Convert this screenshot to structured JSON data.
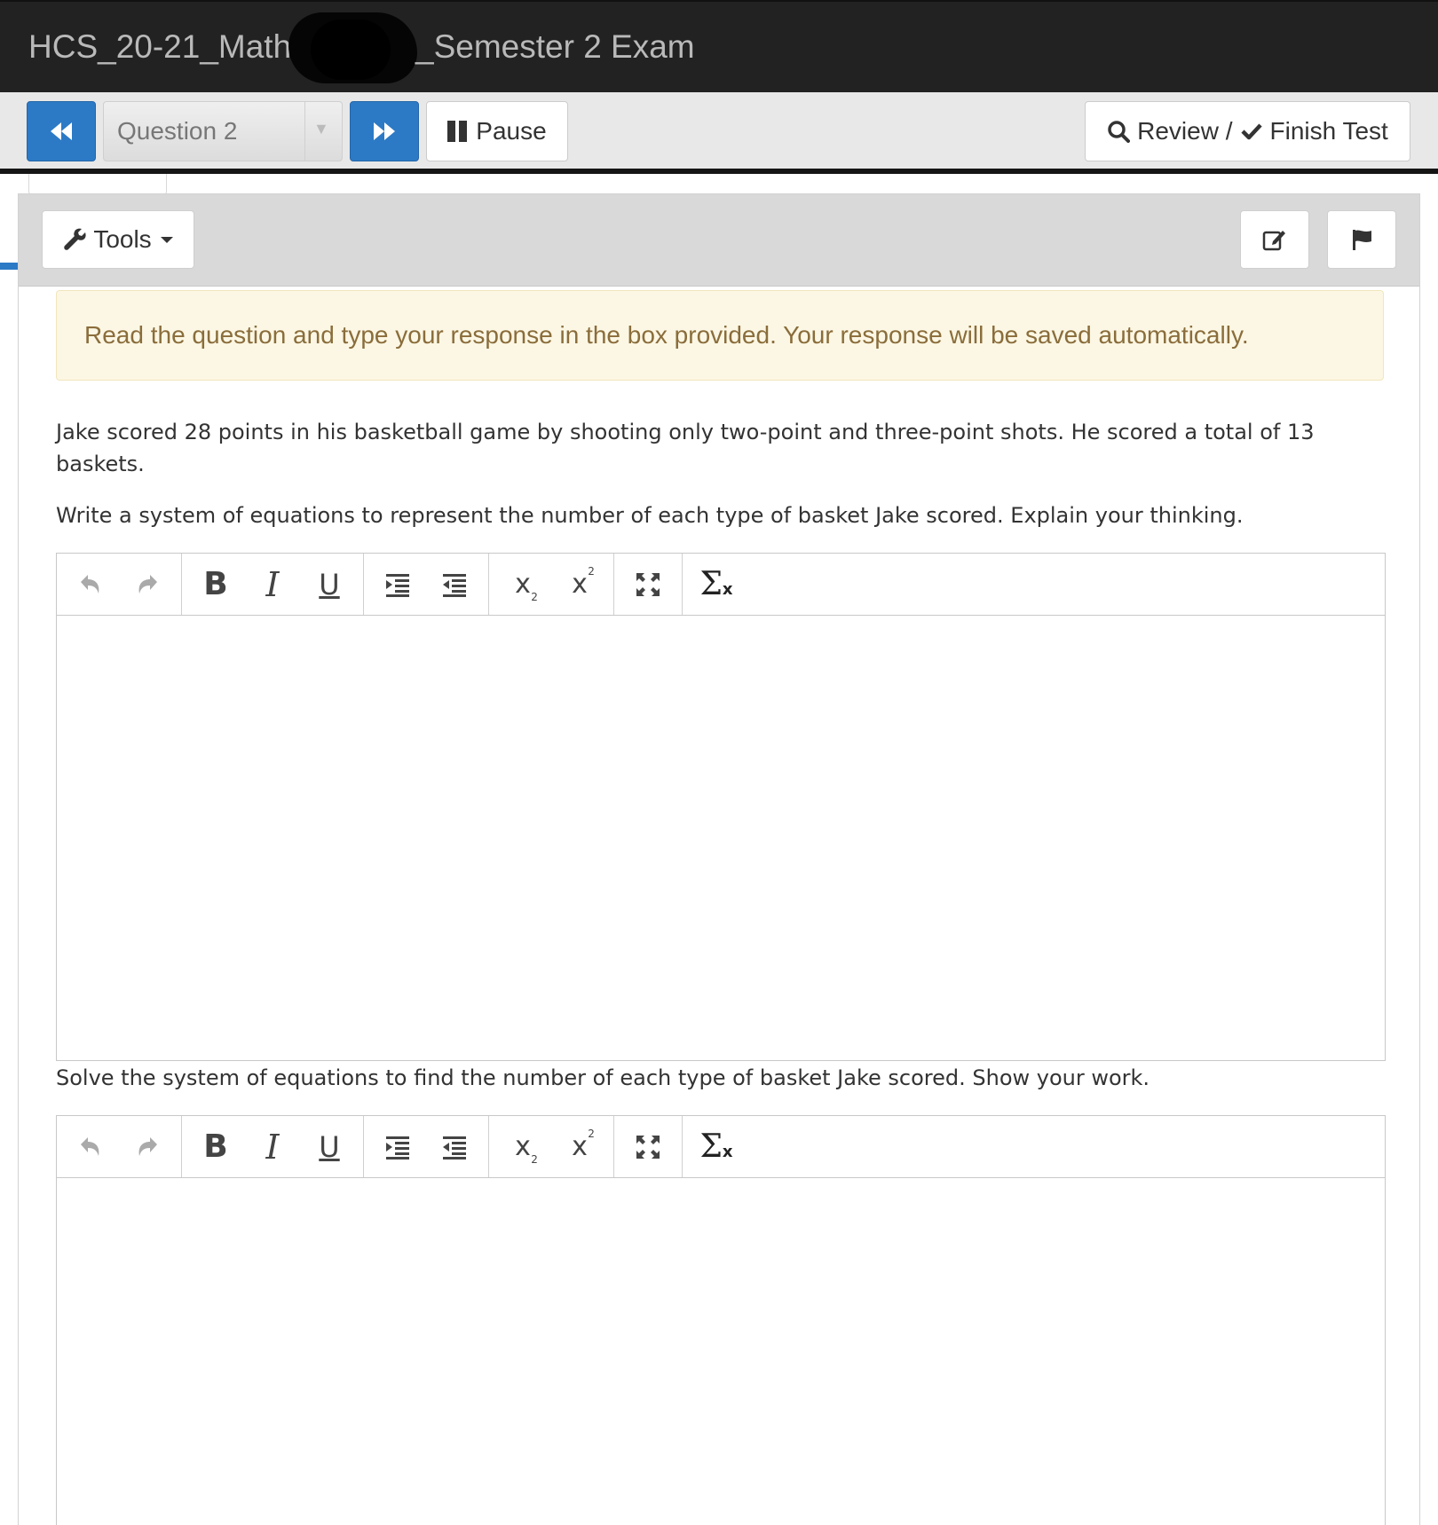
{
  "window": {
    "title_left": "HCS_20-21_Math",
    "title_right": "_Semester 2 Exam"
  },
  "nav": {
    "prev_icon": "fast-backward-icon",
    "question_select": "Question 2",
    "next_icon": "fast-forward-icon",
    "pause_label": "Pause",
    "review_label": "Review /",
    "finish_label": "Finish Test"
  },
  "tools": {
    "tools_label": "Tools",
    "edit_icon": "pencil-square-icon",
    "flag_icon": "flag-icon"
  },
  "instruction": "Read the question and type your response in the box provided. Your response will be saved automatically.",
  "question": {
    "paragraph1": "Jake scored 28 points in his basketball game by shooting only two-point and three-point shots. He scored a total of 13 baskets.",
    "paragraph2": "Write a system of equations to represent the number of each type of basket Jake scored. Explain your thinking.",
    "paragraph3": "Solve the system of equations to find the number of each type of basket Jake scored. Show your work."
  },
  "editor_toolbar": {
    "bold": "B",
    "italic": "I",
    "underline": "U",
    "subscript": "x",
    "subscript_mark": "2",
    "superscript": "x",
    "superscript_mark": "2",
    "sigma": "Σ",
    "sigma_x": "x"
  },
  "colors": {
    "titlebar_bg": "#222222",
    "accent_blue": "#2c7ac6",
    "instruction_bg": "#fcf7e4",
    "instruction_text": "#8a6d3b"
  }
}
